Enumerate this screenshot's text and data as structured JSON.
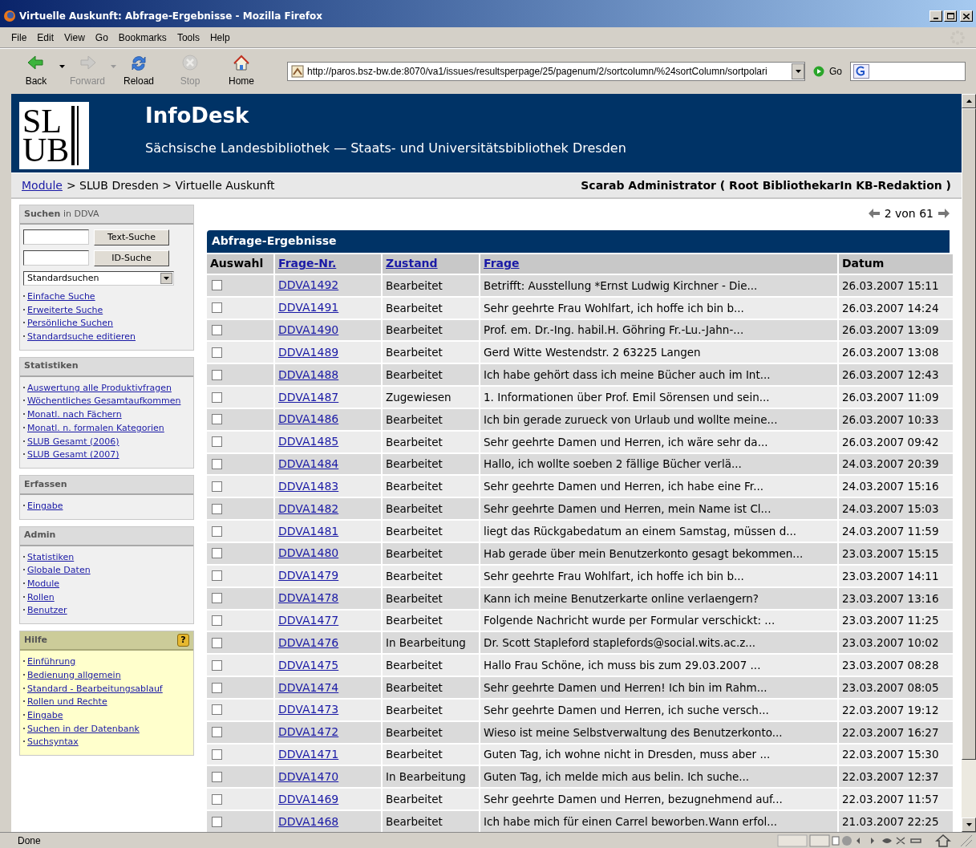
{
  "window": {
    "title": "Virtuelle Auskunft: Abfrage-Ergebnisse - Mozilla Firefox"
  },
  "menu": [
    "File",
    "Edit",
    "View",
    "Go",
    "Bookmarks",
    "Tools",
    "Help"
  ],
  "toolbar": [
    {
      "kind": "back",
      "label": "Back",
      "disabled": false,
      "dropdown": true
    },
    {
      "kind": "forward",
      "label": "Forward",
      "disabled": true,
      "dropdown": true
    },
    {
      "kind": "reload",
      "label": "Reload",
      "disabled": false,
      "dropdown": false
    },
    {
      "kind": "stop",
      "label": "Stop",
      "disabled": true,
      "dropdown": false
    },
    {
      "kind": "home",
      "label": "Home",
      "disabled": false,
      "dropdown": false
    }
  ],
  "address": {
    "value": "http://paros.bsz-bw.de:8070/va1/issues/resultsperpage/25/pagenum/2/sortcolumn/%24sortColumn/sortpolari"
  },
  "go_label": "Go",
  "header": {
    "logo": [
      "SL",
      "UB"
    ],
    "title": "InfoDesk",
    "subtitle": "Sächsische Landesbibliothek — Staats- und Universitätsbibliothek Dresden"
  },
  "breadcrumb": {
    "link": "Module",
    "rest": "> SLUB Dresden > Virtuelle Auskunft",
    "user": "Scarab Administrator ( Root BibliothekarIn KB-Redaktion )"
  },
  "sidebar": [
    {
      "kind": "search",
      "title": "**Suchen** in DDVA",
      "buttons": [
        "Text-Suche",
        "ID-Suche"
      ],
      "select": "Standardsuchen",
      "items": [
        "Einfache Suche",
        "Erweiterte Suche",
        "Persönliche Suchen",
        "Standardsuche editieren"
      ]
    },
    {
      "kind": "links",
      "title": "Statistiken",
      "items": [
        "Auswertung alle Produktivfragen",
        "Wöchentliches Gesamtaufkommen",
        "Monatl. nach Fächern",
        "Monatl. n. formalen Kategorien",
        "SLUB Gesamt (2006)",
        "SLUB Gesamt (2007)"
      ]
    },
    {
      "kind": "links",
      "title": "Erfassen",
      "items": [
        "Eingabe"
      ]
    },
    {
      "kind": "links",
      "title": "Admin",
      "items": [
        "Statistiken",
        "Globale Daten",
        "Module",
        "Rollen",
        "Benutzer"
      ]
    },
    {
      "kind": "help",
      "title": "Hilfe",
      "badge": "?",
      "items": [
        "Einführung",
        "Bedienung allgemein",
        "Standard - Bearbeitungsablauf",
        "Rollen und Rechte",
        "Eingabe",
        "Suchen in der Datenbank",
        "Suchsyntax"
      ]
    }
  ],
  "pager": "2 von 61",
  "table": {
    "title": "Abfrage-Ergebnisse",
    "columns": [
      {
        "label": "Auswahl",
        "link": false
      },
      {
        "label": "Frage-Nr.",
        "link": true
      },
      {
        "label": "Zustand",
        "link": true
      },
      {
        "label": "Frage",
        "link": true
      },
      {
        "label": "Datum",
        "link": false
      }
    ],
    "rows": [
      {
        "checked": false,
        "id": "DDVA1492",
        "status": "Bearbeitet",
        "question": "Betrifft: Ausstellung *Ernst Ludwig Kirchner - Die...",
        "date": "26.03.2007 15:11"
      },
      {
        "checked": false,
        "id": "DDVA1491",
        "status": "Bearbeitet",
        "question": "Sehr geehrte Frau Wohlfart, ich hoffe ich bin b...",
        "date": "26.03.2007 14:24"
      },
      {
        "checked": false,
        "id": "DDVA1490",
        "status": "Bearbeitet",
        "question": "Prof. em. Dr.-Ing. habil.H. Göhring Fr.-Lu.-Jahn-...",
        "date": "26.03.2007 13:09"
      },
      {
        "checked": false,
        "id": "DDVA1489",
        "status": "Bearbeitet",
        "question": "Gerd Witte Westendstr. 2 63225 Langen",
        "date": "26.03.2007 13:08"
      },
      {
        "checked": false,
        "id": "DDVA1488",
        "status": "Bearbeitet",
        "question": "Ich habe gehört dass ich meine Bücher auch im Int...",
        "date": "26.03.2007 12:43"
      },
      {
        "checked": false,
        "id": "DDVA1487",
        "status": "Zugewiesen",
        "question": "1. Informationen über Prof. Emil Sörensen und sein...",
        "date": "26.03.2007 11:09"
      },
      {
        "checked": false,
        "id": "DDVA1486",
        "status": "Bearbeitet",
        "question": "Ich bin gerade zurueck von Urlaub und wollte meine...",
        "date": "26.03.2007 10:33"
      },
      {
        "checked": false,
        "id": "DDVA1485",
        "status": "Bearbeitet",
        "question": "Sehr geehrte Damen und Herren, ich wäre sehr da...",
        "date": "26.03.2007 09:42"
      },
      {
        "checked": false,
        "id": "DDVA1484",
        "status": "Bearbeitet",
        "question": "Hallo, ich wollte soeben 2 fällige Bücher verlä...",
        "date": "24.03.2007 20:39"
      },
      {
        "checked": false,
        "id": "DDVA1483",
        "status": "Bearbeitet",
        "question": "Sehr geehrte Damen und Herren, ich habe eine Fr...",
        "date": "24.03.2007 15:16"
      },
      {
        "checked": false,
        "id": "DDVA1482",
        "status": "Bearbeitet",
        "question": "Sehr geehrte Damen und Herren, mein Name ist Cl...",
        "date": "24.03.2007 15:03"
      },
      {
        "checked": false,
        "id": "DDVA1481",
        "status": "Bearbeitet",
        "question": "liegt das Rückgabedatum an einem Samstag, müssen d...",
        "date": "24.03.2007 11:59"
      },
      {
        "checked": false,
        "id": "DDVA1480",
        "status": "Bearbeitet",
        "question": "Hab gerade über mein Benutzerkonto gesagt bekommen...",
        "date": "23.03.2007 15:15"
      },
      {
        "checked": false,
        "id": "DDVA1479",
        "status": "Bearbeitet",
        "question": "Sehr geehrte Frau Wohlfart, ich hoffe ich bin b...",
        "date": "23.03.2007 14:11"
      },
      {
        "checked": false,
        "id": "DDVA1478",
        "status": "Bearbeitet",
        "question": "Kann ich meine Benutzerkarte online verlaengern?",
        "date": "23.03.2007 13:16"
      },
      {
        "checked": false,
        "id": "DDVA1477",
        "status": "Bearbeitet",
        "question": "Folgende Nachricht wurde per Formular verschickt: ...",
        "date": "23.03.2007 11:25"
      },
      {
        "checked": false,
        "id": "DDVA1476",
        "status": "In Bearbeitung",
        "question": "Dr. Scott Stapleford staplefords@social.wits.ac.z...",
        "date": "23.03.2007 10:02"
      },
      {
        "checked": false,
        "id": "DDVA1475",
        "status": "Bearbeitet",
        "question": "Hallo Frau Schöne, ich muss bis zum 29.03.2007 ...",
        "date": "23.03.2007 08:28"
      },
      {
        "checked": false,
        "id": "DDVA1474",
        "status": "Bearbeitet",
        "question": "Sehr geehrte Damen und Herren! Ich bin im Rahm...",
        "date": "23.03.2007 08:05"
      },
      {
        "checked": false,
        "id": "DDVA1473",
        "status": "Bearbeitet",
        "question": "Sehr geehrte Damen und Herren, ich suche versch...",
        "date": "22.03.2007 19:12"
      },
      {
        "checked": false,
        "id": "DDVA1472",
        "status": "Bearbeitet",
        "question": "Wieso ist meine Selbstverwaltung des Benutzerkonto...",
        "date": "22.03.2007 16:27"
      },
      {
        "checked": false,
        "id": "DDVA1471",
        "status": "Bearbeitet",
        "question": "Guten Tag, ich wohne nicht in Dresden, muss aber ...",
        "date": "22.03.2007 15:30"
      },
      {
        "checked": false,
        "id": "DDVA1470",
        "status": "In Bearbeitung",
        "question": "Guten Tag, ich melde mich aus belin. Ich suche...",
        "date": "22.03.2007 12:37"
      },
      {
        "checked": false,
        "id": "DDVA1469",
        "status": "Bearbeitet",
        "question": "Sehr geehrte Damen und Herren, bezugnehmend auf...",
        "date": "22.03.2007 11:57"
      },
      {
        "checked": false,
        "id": "DDVA1468",
        "status": "Bearbeitet",
        "question": "Ich habe mich für einen Carrel beworben.Wann erfol...",
        "date": "21.03.2007 22:25"
      }
    ]
  },
  "status_bar": {
    "text": "Done"
  }
}
